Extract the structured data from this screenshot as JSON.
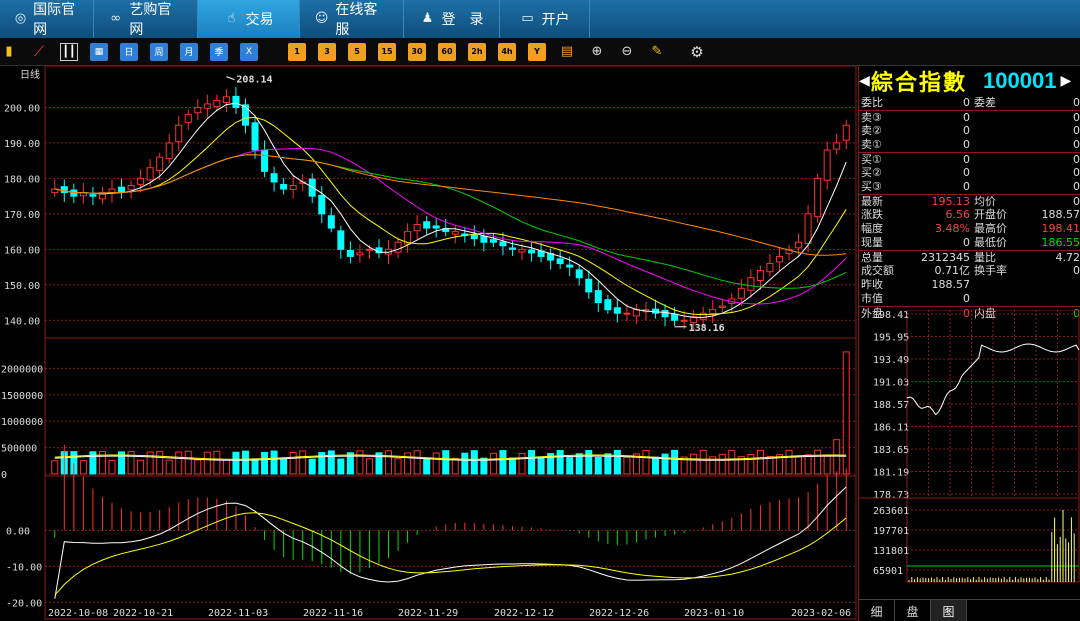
{
  "nav": {
    "tabs": [
      {
        "label": "国际官网",
        "icon": "globe-icon"
      },
      {
        "label": "艺购官网",
        "icon": "link-icon"
      },
      {
        "label": "交易",
        "icon": "thumb-icon"
      },
      {
        "label": "在线客服",
        "icon": "chat-icon"
      },
      {
        "label": "登　录",
        "icon": "user-icon"
      },
      {
        "label": "开户",
        "icon": "monitor-icon"
      }
    ]
  },
  "toolbar": {
    "periods": [
      "日",
      "周",
      "月",
      "季",
      "X"
    ],
    "minutes": [
      "1",
      "3",
      "5",
      "15",
      "30",
      "60",
      "2h",
      "4h",
      "Y"
    ]
  },
  "chart": {
    "period_label": "日线",
    "y_labels": [
      "200.00",
      "190.00",
      "180.00",
      "170.00",
      "160.00",
      "150.00",
      "140.00"
    ],
    "vol_labels": [
      "2000000",
      "1500000",
      "1000000",
      "500000",
      "0"
    ],
    "macd_labels": [
      "0.00",
      "-10.00",
      "-20.00"
    ],
    "x_labels": [
      "2022-10-08",
      "2022-10-21",
      "2022-11-03",
      "2022-11-16",
      "2022-11-29",
      "2022-12-12",
      "2022-12-26",
      "2023-01-10",
      "2023-02-06"
    ],
    "high_annotation": "208.14",
    "low_annotation": "138.16"
  },
  "chart_data": {
    "type": "candlestick",
    "x_range": [
      "2022-10-08",
      "2023-02-06"
    ],
    "ylim": [
      135,
      210
    ],
    "high": 208.14,
    "low": 138.16,
    "close_series": [
      177,
      176,
      175,
      176,
      175,
      176,
      177,
      176,
      178,
      180,
      183,
      186,
      190,
      195,
      198,
      200,
      201,
      202,
      203,
      200,
      195,
      188,
      182,
      179,
      177,
      178,
      179,
      175,
      170,
      166,
      160,
      158,
      159,
      160,
      159,
      160,
      162,
      165,
      167,
      166,
      166,
      165,
      165,
      164,
      163,
      162,
      162,
      161,
      160,
      160,
      159,
      158,
      157,
      156,
      155,
      152,
      148,
      145,
      143,
      142,
      142,
      143,
      143,
      142,
      141,
      140,
      140,
      141,
      142,
      143,
      144,
      146,
      149,
      152,
      154,
      156,
      158,
      160,
      162,
      170,
      180,
      188,
      190,
      195
    ],
    "volume_ylim": [
      0,
      2500000
    ],
    "macd_ylim": [
      -21,
      14
    ]
  },
  "quote": {
    "title": "綜合指數",
    "code": "100001",
    "rows": [
      {
        "l1": "委比",
        "v1": "0",
        "l2": "委差",
        "v2": "0"
      },
      {
        "l1": "卖③",
        "v1": "0",
        "l2": "",
        "v2": "0"
      },
      {
        "l1": "卖②",
        "v1": "0",
        "l2": "",
        "v2": "0"
      },
      {
        "l1": "卖①",
        "v1": "0",
        "l2": "",
        "v2": "0"
      },
      {
        "l1": "买①",
        "v1": "0",
        "l2": "",
        "v2": "0"
      },
      {
        "l1": "买②",
        "v1": "0",
        "l2": "",
        "v2": "0"
      },
      {
        "l1": "买③",
        "v1": "0",
        "l2": "",
        "v2": "0"
      },
      {
        "l1": "最新",
        "v1": "195.13",
        "l2": "均价",
        "v2": "0"
      },
      {
        "l1": "涨跌",
        "v1": "6.56",
        "l2": "开盘价",
        "v2": "188.57"
      },
      {
        "l1": "幅度",
        "v1": "3.48%",
        "l2": "最高价",
        "v2": "198.41"
      },
      {
        "l1": "现量",
        "v1": "0",
        "l2": "最低价",
        "v2": "186.55"
      },
      {
        "l1": "总量",
        "v1": "2312345",
        "l2": "量比",
        "v2": "4.72"
      },
      {
        "l1": "成交额",
        "v1": "0.71亿",
        "l2": "换手率",
        "v2": "0"
      },
      {
        "l1": "昨收",
        "v1": "188.57",
        "l2": "",
        "v2": ""
      },
      {
        "l1": "市值",
        "v1": "0",
        "l2": "",
        "v2": ""
      },
      {
        "l1": "外盘",
        "v1": "0",
        "l2": "内盘",
        "v2": "0"
      }
    ]
  },
  "intraday": {
    "price_labels": [
      "198.41",
      "195.95",
      "193.49",
      "191.03",
      "188.57",
      "186.11",
      "183.65",
      "181.19",
      "178.73"
    ],
    "vol_labels": [
      "263601",
      "197701",
      "131801",
      "65901"
    ]
  },
  "bottom_tabs": [
    "细",
    "盘",
    "图"
  ],
  "colors": {
    "up": "#ff3030",
    "down": "#00ffff",
    "grid": "#8a1a1a"
  }
}
